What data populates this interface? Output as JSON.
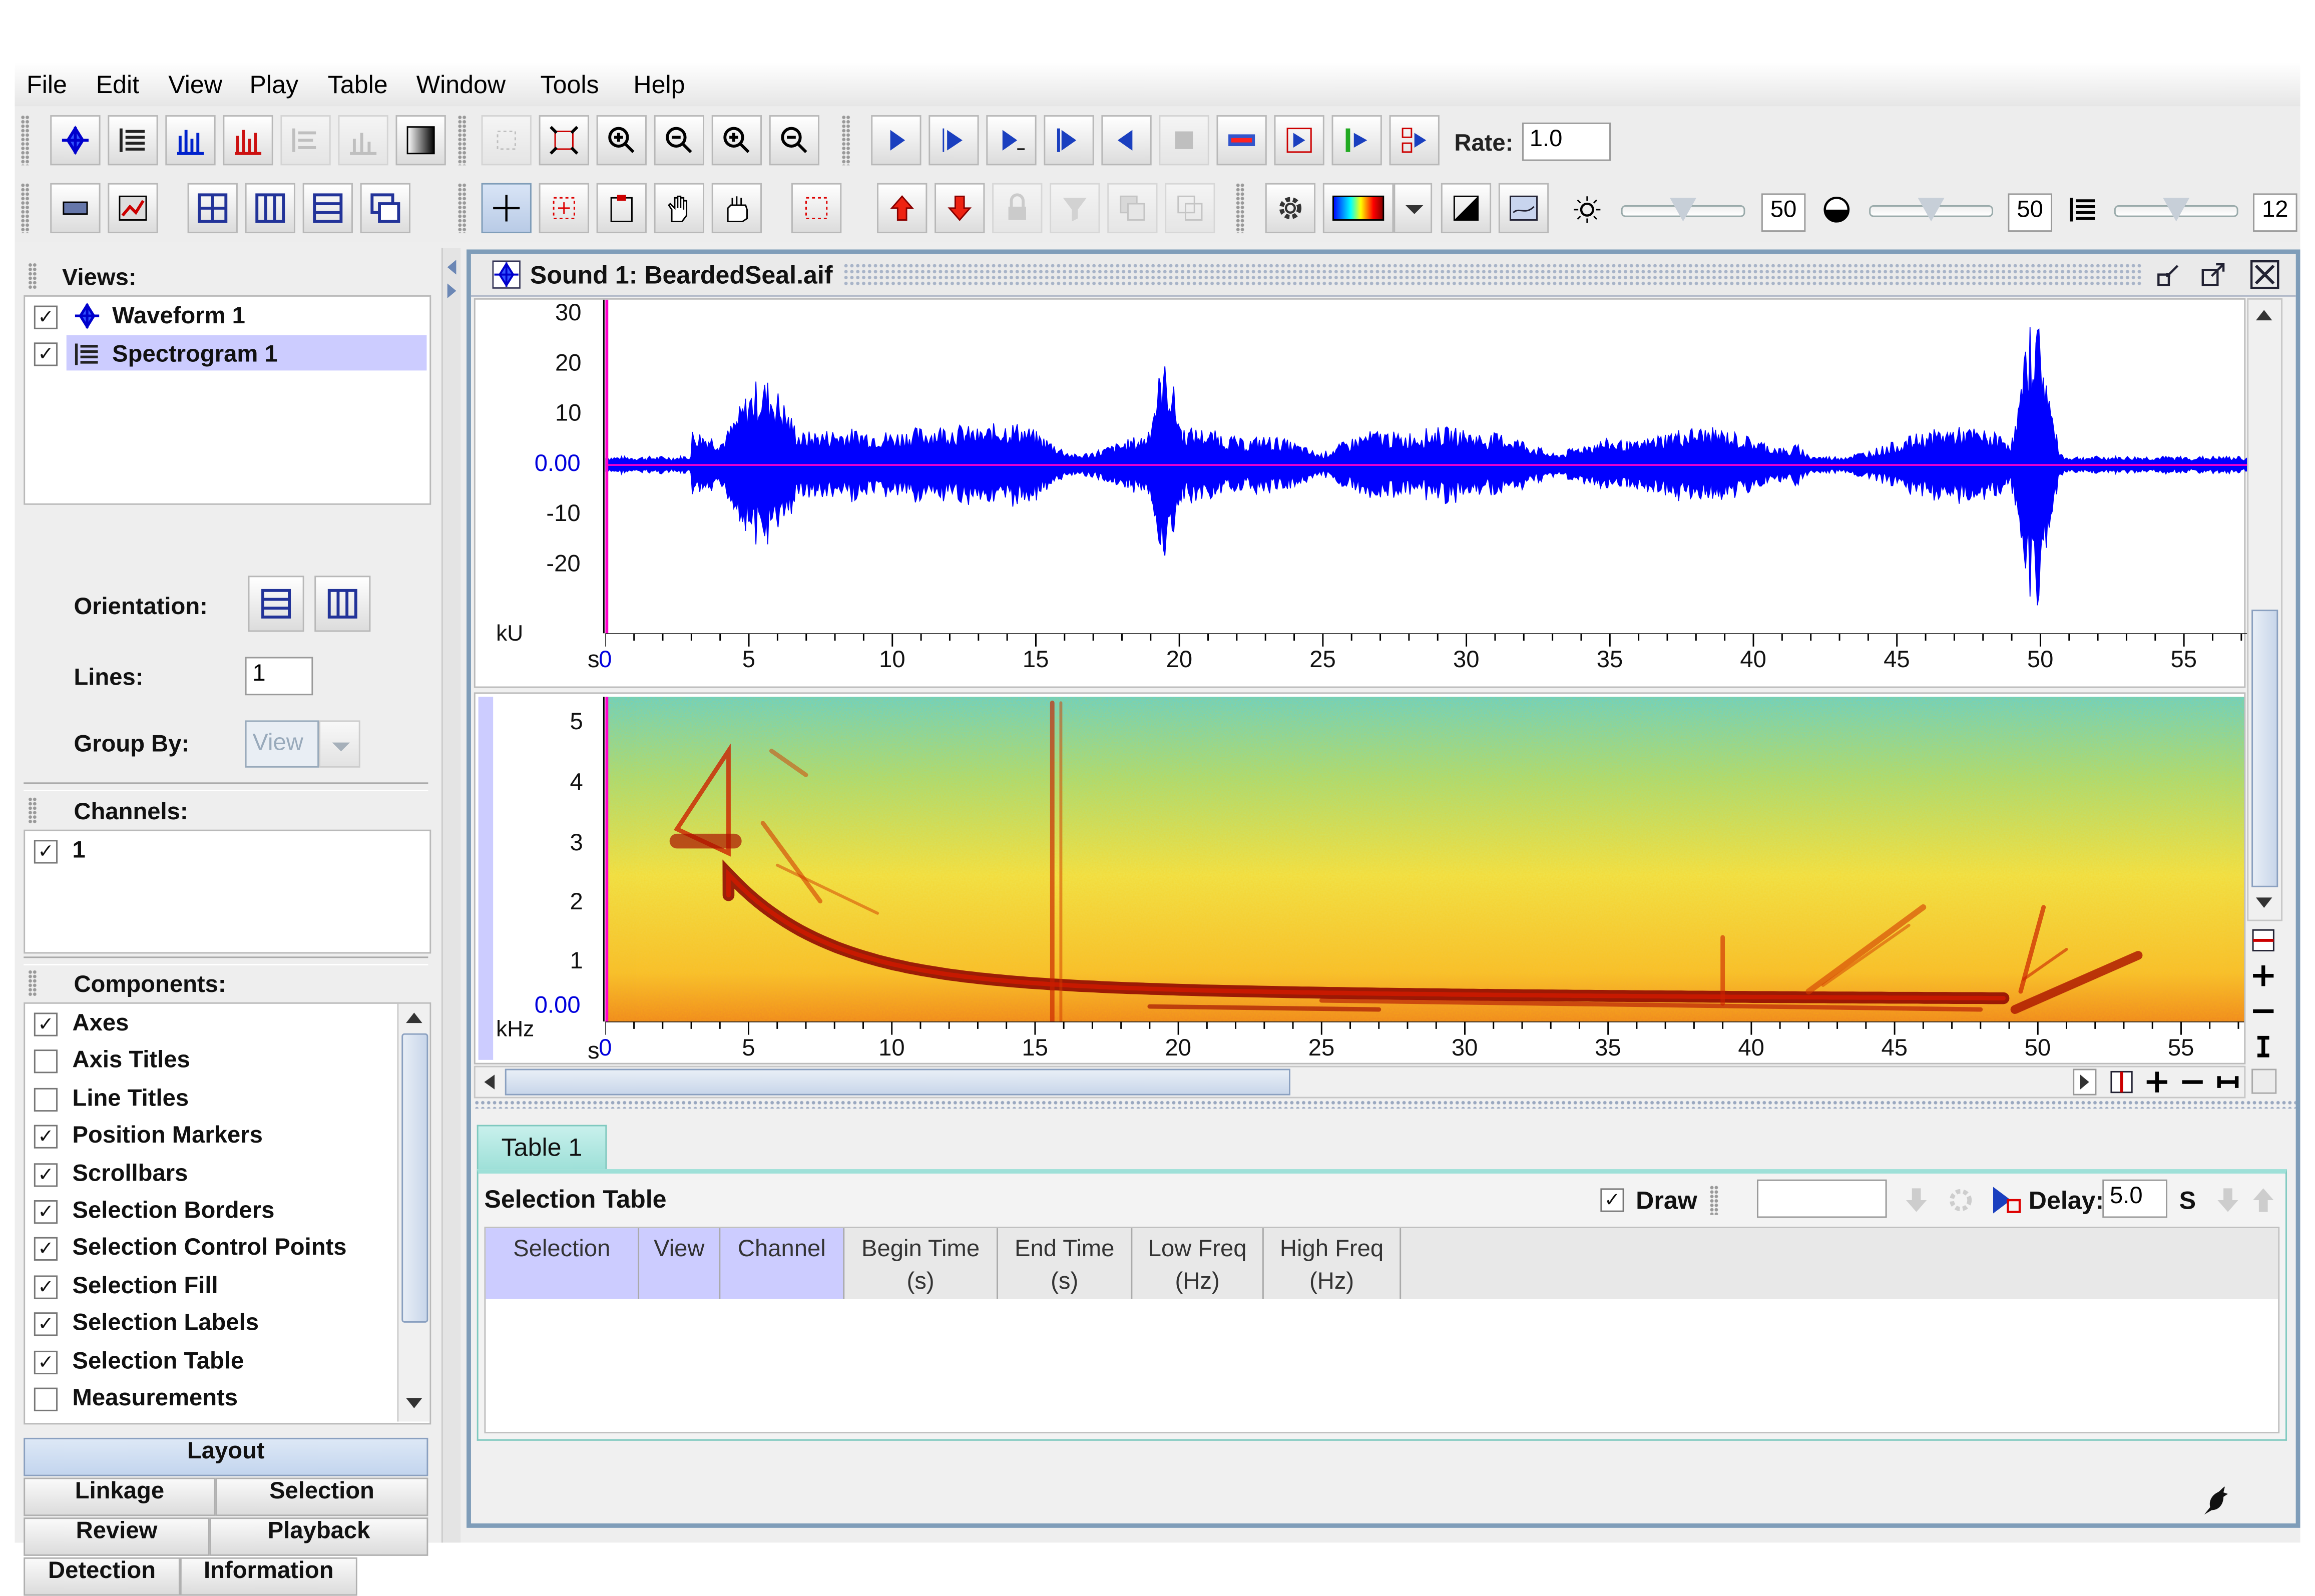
{
  "menu": [
    "File",
    "Edit",
    "View",
    "Play",
    "Table",
    "Window",
    "Tools",
    "Help"
  ],
  "toolbar": {
    "rate_label": "Rate:",
    "rate_value": "1.0",
    "brightness_value": "50",
    "contrast_value": "50",
    "lines_value": "12"
  },
  "sidebar": {
    "views_header": "Views:",
    "views": [
      {
        "label": "Waveform 1",
        "checked": true
      },
      {
        "label": "Spectrogram 1",
        "checked": true
      }
    ],
    "orientation_label": "Orientation:",
    "lines_label": "Lines:",
    "lines_value": "1",
    "group_by_label": "Group By:",
    "group_by_value": "View",
    "channels_header": "Channels:",
    "channels": [
      "1"
    ],
    "components_header": "Components:",
    "components": [
      {
        "label": "Axes",
        "checked": true
      },
      {
        "label": "Axis Titles",
        "checked": false
      },
      {
        "label": "Line Titles",
        "checked": false
      },
      {
        "label": "Position Markers",
        "checked": true
      },
      {
        "label": "Scrollbars",
        "checked": true
      },
      {
        "label": "Selection Borders",
        "checked": true
      },
      {
        "label": "Selection Control Points",
        "checked": true
      },
      {
        "label": "Selection Fill",
        "checked": true
      },
      {
        "label": "Selection Labels",
        "checked": true
      },
      {
        "label": "Selection Table",
        "checked": true
      },
      {
        "label": "Measurements",
        "checked": false
      }
    ],
    "tabs": [
      "Layout",
      "Linkage",
      "Selection",
      "Review",
      "Playback",
      "Detection",
      "Information"
    ]
  },
  "document": {
    "title": "Sound 1: BeardedSeal.aif",
    "waveform": {
      "y_ticks": [
        "30",
        "20",
        "10",
        "0.00",
        "-10",
        "-20"
      ],
      "unit": "kU",
      "x_unit": "s",
      "x_ticks": [
        "0",
        "5",
        "10",
        "15",
        "20",
        "25",
        "30",
        "35",
        "40",
        "45",
        "50",
        "55"
      ]
    },
    "spectrogram": {
      "y_ticks": [
        "5",
        "4",
        "3",
        "2",
        "1",
        "0.00"
      ],
      "unit": "kHz",
      "x_unit": "s",
      "x_ticks": [
        "0",
        "5",
        "10",
        "15",
        "20",
        "25",
        "30",
        "35",
        "40",
        "45",
        "50",
        "55"
      ]
    }
  },
  "table": {
    "tab": "Table 1",
    "title": "Selection Table",
    "draw_label": "Draw",
    "delay_label": "Delay:",
    "delay_value": "5.0",
    "delay_unit": "S",
    "columns": [
      "Selection",
      "View",
      "Channel",
      "Begin Time\n(s)",
      "End Time\n(s)",
      "Low Freq\n(Hz)",
      "High Freq\n(Hz)"
    ]
  },
  "colors": {
    "waveform": "#0000ff",
    "zero_line": "#ff00cc",
    "selection_highlight": "#ccccff"
  }
}
